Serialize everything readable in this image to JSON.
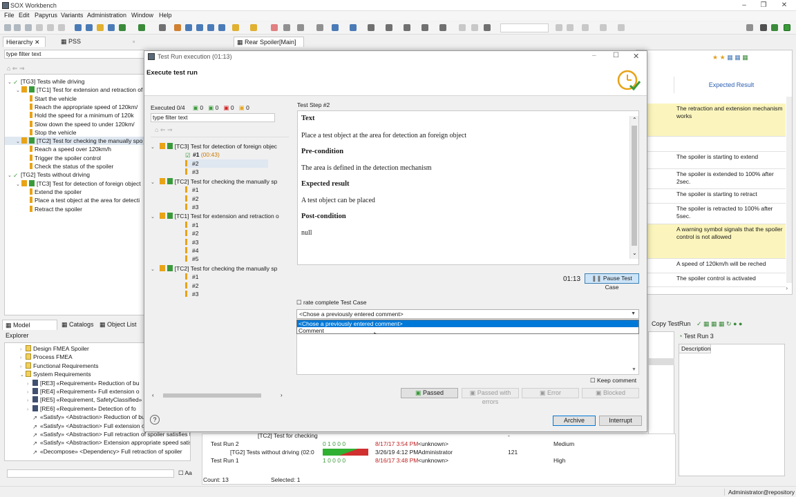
{
  "app": {
    "title": "SOX Workbench"
  },
  "menu": [
    "File",
    "Edit",
    "Papyrus",
    "Variants",
    "Administration",
    "Window",
    "Help"
  ],
  "left_tabs": {
    "hierarchy": "Hierarchy",
    "pss": "PSS"
  },
  "filter_placeholder": "type filter text",
  "hierarchy": [
    {
      "text": "[TG3] Tests while driving",
      "level": 0,
      "kind": "group"
    },
    {
      "text": "[TC1] Test for extension and retraction of",
      "level": 1,
      "kind": "case"
    },
    {
      "text": "Start the vehicle",
      "level": 2,
      "kind": "step"
    },
    {
      "text": "Reach the appropriate speed of  120km/",
      "level": 2,
      "kind": "step"
    },
    {
      "text": "Hold the speed for a minimum of  120k",
      "level": 2,
      "kind": "step"
    },
    {
      "text": "Slow down the speed to under  120km/",
      "level": 2,
      "kind": "step"
    },
    {
      "text": "Stop the vehicle",
      "level": 2,
      "kind": "step"
    },
    {
      "text": "[TC2] Test for checking the manually spo",
      "level": 1,
      "kind": "case",
      "selected": true
    },
    {
      "text": "Reach a speed over 120km/h",
      "level": 2,
      "kind": "step"
    },
    {
      "text": "Trigger the spoiler control",
      "level": 2,
      "kind": "step"
    },
    {
      "text": "Check the status of the spoiler",
      "level": 2,
      "kind": "step"
    },
    {
      "text": "[TG2] Tests without driving",
      "level": 0,
      "kind": "group"
    },
    {
      "text": "[TC3] Test for detection of foreign object",
      "level": 1,
      "kind": "case"
    },
    {
      "text": "Extend the spoiler",
      "level": 2,
      "kind": "step"
    },
    {
      "text": "Place a test object at the area for detecti",
      "level": 2,
      "kind": "step"
    },
    {
      "text": "Retract the spoiler",
      "level": 2,
      "kind": "step"
    }
  ],
  "model_tabs": {
    "model_explorer": "Model Explorer",
    "catalogs": "Catalogs",
    "object_list": "Object List"
  },
  "model_tree": [
    "Design FMEA Spoiler",
    "Process FMEA",
    "Functional Requirements",
    "System Requirements",
    "[RE3] «Requirement» Reduction of bu",
    "[RE4] «Requirement» Full extension o",
    "[RE5] «Requirement, SafetyClassified»",
    "[RE6] «Requirement» Detection of fo",
    "«Satisfy» <Abstraction> Reduction of bu",
    "«Satisfy» <Abstraction> Full extension o",
    "«Satisfy» <Abstraction> Full retraction of spoiler satisfies t",
    "«Satisfy» <Abstraction> Extension appropriate speed satist",
    "«Decompose» <Dependency> Full retraction of spoiler"
  ],
  "editor_tab": "Rear Spoiler[Main]",
  "right_panel": {
    "header": "Expected Result",
    "rows": [
      {
        "text": "The retraction and extension mechanism works",
        "yellow": true
      },
      {
        "text": "",
        "yellow": false
      },
      {
        "text": "The spoiler is starting to extend",
        "yellow": false
      },
      {
        "text": "The spoiler is extended to 100% after 2sec.",
        "yellow": false
      },
      {
        "text": "The spoiler is starting to retract",
        "yellow": false
      },
      {
        "text": "The spoiler is retracted to 100% after 5sec.",
        "yellow": false
      },
      {
        "text": "A warning symbol signals that the spoiler control is not allowed",
        "yellow": true
      },
      {
        "text": "A speed of 120km/h will be reched",
        "yellow": false
      },
      {
        "text": "The spoiler control is activated",
        "yellow": false
      }
    ],
    "left_fragment": "nism"
  },
  "lower_right": {
    "copy": "Copy TestRun",
    "testrun": "Test Run 3",
    "description": "Description"
  },
  "bottom_table": {
    "rows": [
      {
        "name": "[TC2] Test for checking",
        "col2": "",
        "date": "",
        "user": "",
        "num": "-",
        "prio": ""
      },
      {
        "name": "Test Run 2",
        "col2": "0 1 0 0 0",
        "date": "8/17/17 3:54 PM",
        "user": "<unknown>",
        "num": "",
        "prio": "Medium"
      },
      {
        "name": "[TG2] Tests without driving",
        "time": "(02:0",
        "col2": "",
        "date": "3/26/19 4:12 PM",
        "user": "Administrator",
        "num": "121",
        "prio": ""
      },
      {
        "name": "Test Run 1",
        "col2": "1 0 0 0 0",
        "date": "8/16/17 3:48 PM",
        "user": "<unknown>",
        "num": "",
        "prio": "High"
      }
    ],
    "count": "Count: 13",
    "selected": "Selected: 1"
  },
  "status": {
    "user": "Administrator@repository",
    "aa": "Aa"
  },
  "dialog": {
    "title": "Test Run execution (01:13)",
    "heading": "Execute test run",
    "executed": "Executed 0/4",
    "counters": [
      "0",
      "0",
      "0",
      "0"
    ],
    "filter": "type filter text",
    "tree": [
      {
        "t": "[TC3] Test for detection of foreign objec",
        "lvl": 0
      },
      {
        "t": "#1",
        "time": "(00:43)",
        "lvl": 1,
        "bold": true,
        "check": true
      },
      {
        "t": "#2",
        "lvl": 1,
        "sel": true
      },
      {
        "t": "#3",
        "lvl": 1
      },
      {
        "t": "[TC2] Test for checking the manually sp",
        "lvl": 0
      },
      {
        "t": "#1",
        "lvl": 1
      },
      {
        "t": "#2",
        "lvl": 1
      },
      {
        "t": "#3",
        "lvl": 1
      },
      {
        "t": "[TC1] Test for extension and retraction o",
        "lvl": 0
      },
      {
        "t": "#1",
        "lvl": 1
      },
      {
        "t": "#2",
        "lvl": 1
      },
      {
        "t": "#3",
        "lvl": 1
      },
      {
        "t": "#4",
        "lvl": 1
      },
      {
        "t": "#5",
        "lvl": 1
      },
      {
        "t": "[TC2] Test for checking the manually sp",
        "lvl": 0
      },
      {
        "t": "#1",
        "lvl": 1
      },
      {
        "t": "#2",
        "lvl": 1
      },
      {
        "t": "#3",
        "lvl": 1
      }
    ],
    "step_label": "Test Step #2",
    "sections": {
      "text_h": "Text",
      "text": "Place a test object at the area for detection an foreign object",
      "pre_h": "Pre-condition",
      "pre": "The area is defined in the detection mechanism",
      "exp_h": "Expected result",
      "exp": "A test object can be placed",
      "post_h": "Post-condition",
      "post": "null"
    },
    "timer": "01:13",
    "pause": "Pause Test Case",
    "rate": "rate complete Test Case",
    "combo": "<Chose a previously entered comment>",
    "options": [
      "<Chose a previously entered comment>",
      "Comment"
    ],
    "keep": "Keep comment",
    "buttons": {
      "passed": "Passed",
      "passed_err": "Passed with errors",
      "error": "Error",
      "blocked": "Blocked"
    },
    "archive": "Archive",
    "interrupt": "Interrupt",
    "help": "?"
  }
}
